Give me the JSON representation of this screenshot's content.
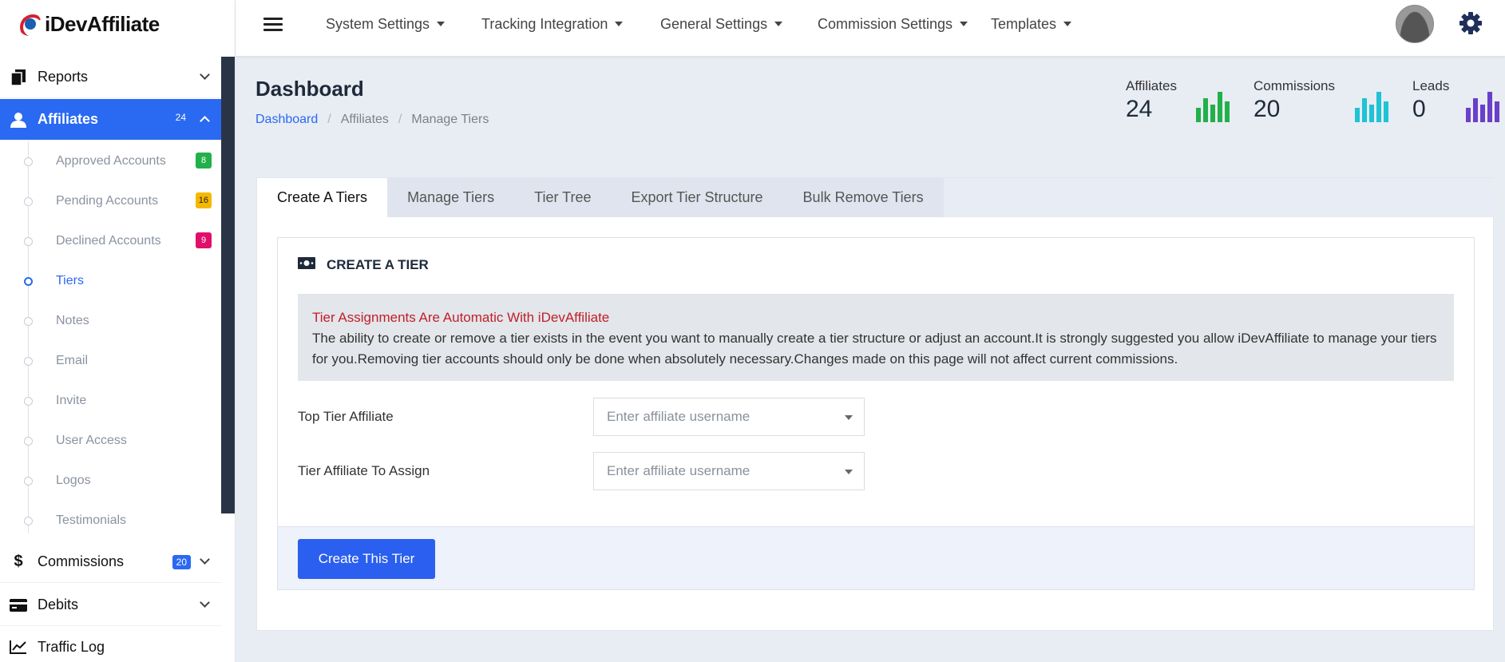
{
  "brand": {
    "logo_text": "iDevAffiliate"
  },
  "sidebar": {
    "reports": "Reports",
    "affiliates": {
      "label": "Affiliates",
      "count": "24"
    },
    "sub_items": [
      {
        "label": "Approved Accounts",
        "badge": "8",
        "badge_color": "#22b04b"
      },
      {
        "label": "Pending Accounts",
        "badge": "16",
        "badge_color": "#f5b800"
      },
      {
        "label": "Declined Accounts",
        "badge": "9",
        "badge_color": "#e0106a"
      },
      {
        "label": "Tiers"
      },
      {
        "label": "Notes"
      },
      {
        "label": "Email"
      },
      {
        "label": "Invite"
      },
      {
        "label": "User Access"
      },
      {
        "label": "Logos"
      },
      {
        "label": "Testimonials"
      }
    ],
    "commissions": {
      "label": "Commissions",
      "count": "20"
    },
    "debits": "Debits",
    "traffic_log": "Traffic Log"
  },
  "topnav": [
    "System Settings",
    "Tracking Integration",
    "General Settings",
    "Commission Settings",
    "Templates"
  ],
  "header": {
    "title": "Dashboard",
    "breadcrumb": [
      "Dashboard",
      "Affiliates",
      "Manage Tiers"
    ]
  },
  "stats": [
    {
      "name": "Affiliates",
      "value": "24",
      "color": "#22b04b"
    },
    {
      "name": "Commissions",
      "value": "20",
      "color": "#1ec3d4"
    },
    {
      "name": "Leads",
      "value": "0",
      "color": "#6a3fc9"
    }
  ],
  "tabs": [
    "Create A Tiers",
    "Manage Tiers",
    "Tier Tree",
    "Export Tier Structure",
    "Bulk Remove Tiers"
  ],
  "panel": {
    "title": "CREATE A TIER",
    "alert_heading": "Tier Assignments Are Automatic With iDevAffiliate",
    "alert_body": "The ability to create or remove a tier exists in the event you want to manually create a tier structure or adjust an account.It is strongly suggested you allow iDevAffiliate to manage your tiers for you.Removing tier accounts should only be done when absolutely necessary.Changes made on this page will not affect current commissions.",
    "top_tier_label": "Top Tier Affiliate",
    "assign_label": "Tier Affiliate To Assign",
    "placeholder": "Enter affiliate username",
    "submit": "Create This Tier"
  }
}
